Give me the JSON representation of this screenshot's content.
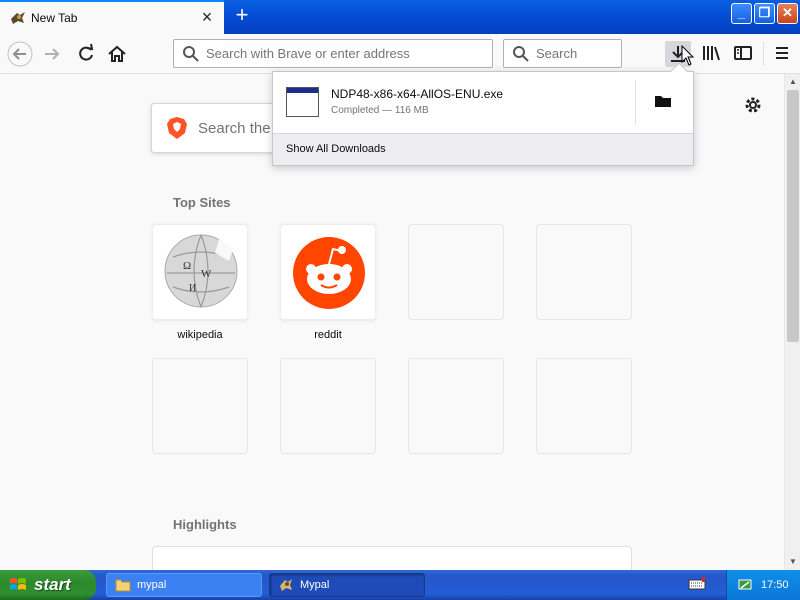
{
  "browser": {
    "tab": {
      "title": "New Tab"
    },
    "urlbar": {
      "placeholder": "Search with Brave or enter address"
    },
    "searchbar": {
      "placeholder": "Search"
    }
  },
  "newtab": {
    "search_placeholder": "Search the",
    "top_sites_title": "Top Sites",
    "top_sites": [
      {
        "label": "wikipedia",
        "icon": "wikipedia-globe-icon"
      },
      {
        "label": "reddit",
        "icon": "reddit-alien-icon"
      }
    ],
    "highlights_title": "Highlights"
  },
  "downloads_panel": {
    "item_name": "NDP48-x86-x64-AllOS-ENU.exe",
    "item_status": "Completed — 116 MB",
    "footer": "Show All Downloads"
  },
  "taskbar": {
    "start_label": "start",
    "tasks": [
      {
        "label": "mypal",
        "icon": "folder-icon"
      },
      {
        "label": "Mypal",
        "icon": "mypal-icon"
      }
    ],
    "clock": "17:50"
  },
  "colors": {
    "titlebar": "#0349d0",
    "reddit_orange": "#ff4500",
    "brave_orange": "#fb542b",
    "taskbar": "#245dd7",
    "start_green": "#2c8a2c"
  }
}
